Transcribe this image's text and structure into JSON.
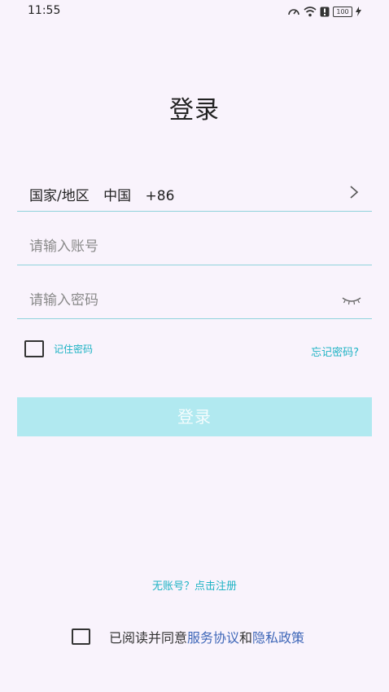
{
  "status_bar": {
    "time": "11:55",
    "battery": "100"
  },
  "page": {
    "title": "登录"
  },
  "region": {
    "label": "国家/地区",
    "country": "中国",
    "code": "+86"
  },
  "account": {
    "placeholder": "请输入账号",
    "value": ""
  },
  "password": {
    "placeholder": "请输入密码",
    "value": ""
  },
  "remember": {
    "label": "记住密码",
    "checked": false
  },
  "forgot": {
    "label": "忘记密码?"
  },
  "login_button": {
    "label": "登录"
  },
  "register": {
    "label": "无账号？点击注册"
  },
  "agreement": {
    "prefix": "已阅读并同意",
    "service_link": "服务协议",
    "and": "和",
    "privacy_link": "隐私政策",
    "checked": false
  },
  "colors": {
    "background": "#f9f3fc",
    "accent": "#1fb3c4",
    "button_disabled": "#b1e9f0",
    "link": "#3f67b8"
  },
  "icons": [
    "speed-icon",
    "wifi-icon",
    "alert-icon",
    "battery-icon",
    "charging-icon",
    "chevron-right-icon",
    "eye-closed-icon"
  ]
}
